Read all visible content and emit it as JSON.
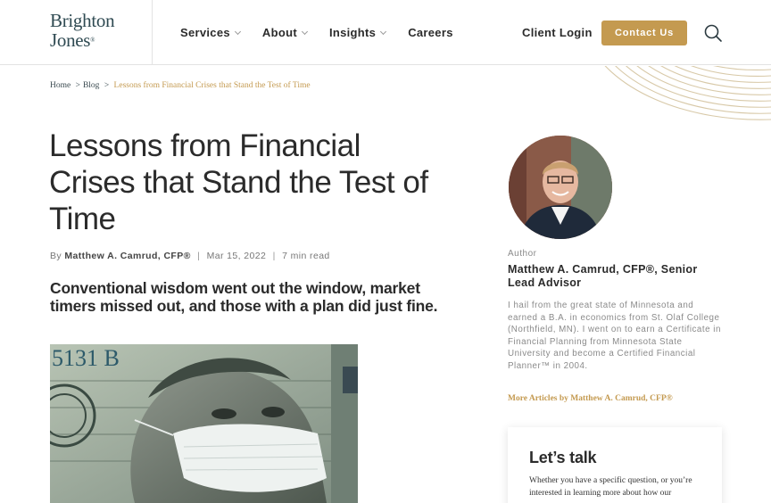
{
  "brand": {
    "line1": "Brighton",
    "line2": "Jones",
    "accent_color": "#c49a50",
    "brand_color": "#2f4a52"
  },
  "nav": {
    "items": [
      {
        "label": "Services",
        "has_dropdown": true
      },
      {
        "label": "About",
        "has_dropdown": true
      },
      {
        "label": "Insights",
        "has_dropdown": true
      },
      {
        "label": "Careers",
        "has_dropdown": false
      }
    ],
    "client_login": "Client Login",
    "contact_button": "Contact Us",
    "search_icon": "search-icon"
  },
  "breadcrumb": {
    "home": "Home",
    "blog": "Blog",
    "sep": ">",
    "current": "Lessons from Financial Crises that Stand the Test of Time"
  },
  "article": {
    "title": "Lessons from Financial Crises that Stand the Test of Time",
    "by": "By",
    "author": "Matthew A. Camrud, CFP®",
    "date": "Mar 15, 2022",
    "read_time": "7 min read",
    "pipe": "|",
    "subtitle": "Conventional wisdom went out the window, market timers missed out, and those with a plan did just fine.",
    "hero_serial": "5131 B"
  },
  "sidebar": {
    "author_label": "Author",
    "author_title": "Matthew A. Camrud, CFP®, Senior Lead Advisor",
    "bio": "I hail from the great state of Minnesota and earned a B.A. in economics from St. Olaf College (Northfield, MN). I went on to earn a Certificate in Financial Planning from Minnesota State University and become a Certified Financial Planner™ in 2004.",
    "more_articles": "More Articles by Matthew A. Camrud, CFP®",
    "talk_title": "Let’s talk",
    "talk_text": "Whether you have a specific question, or you’re interested in learning more about how our"
  }
}
